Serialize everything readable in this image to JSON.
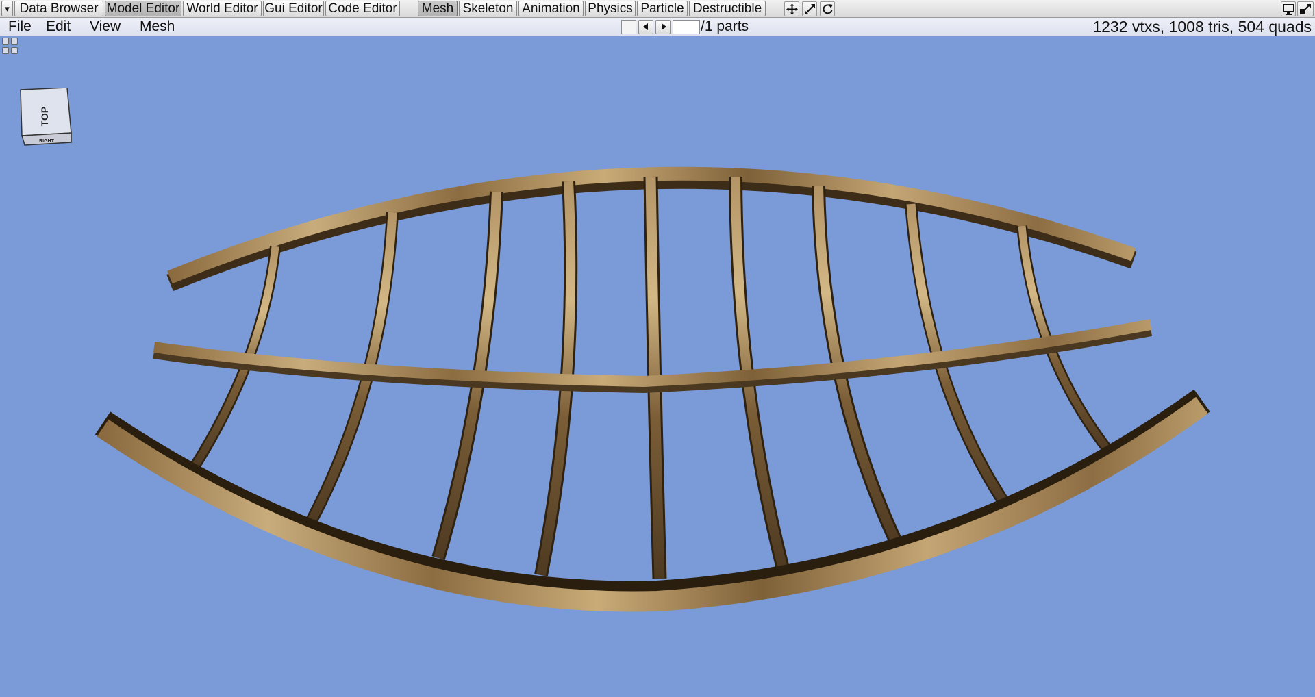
{
  "toolbar": {
    "dropdown_arrow": "▾",
    "editors": [
      "Data Browser",
      "Model Editor",
      "World Editor",
      "Gui Editor",
      "Code Editor"
    ],
    "modes": [
      "Mesh",
      "Skeleton",
      "Animation",
      "Physics",
      "Particle",
      "Destructible"
    ],
    "tools": [
      "move-icon",
      "scale-icon",
      "rotate-icon"
    ],
    "window_icons": [
      "monitor-icon",
      "fullscreen-icon"
    ]
  },
  "menubar": {
    "items": [
      "File",
      "Edit",
      "View",
      "Mesh"
    ],
    "parts_label": "/1 parts",
    "part_value": "",
    "stats": "1232 vtxs, 1008 tris, 504 quads"
  },
  "viewport": {
    "background": "#7a9ad8",
    "view_cube": {
      "top_label": "TOP",
      "side_label": "RIGHT"
    },
    "wood_color": "#a98a5c"
  }
}
